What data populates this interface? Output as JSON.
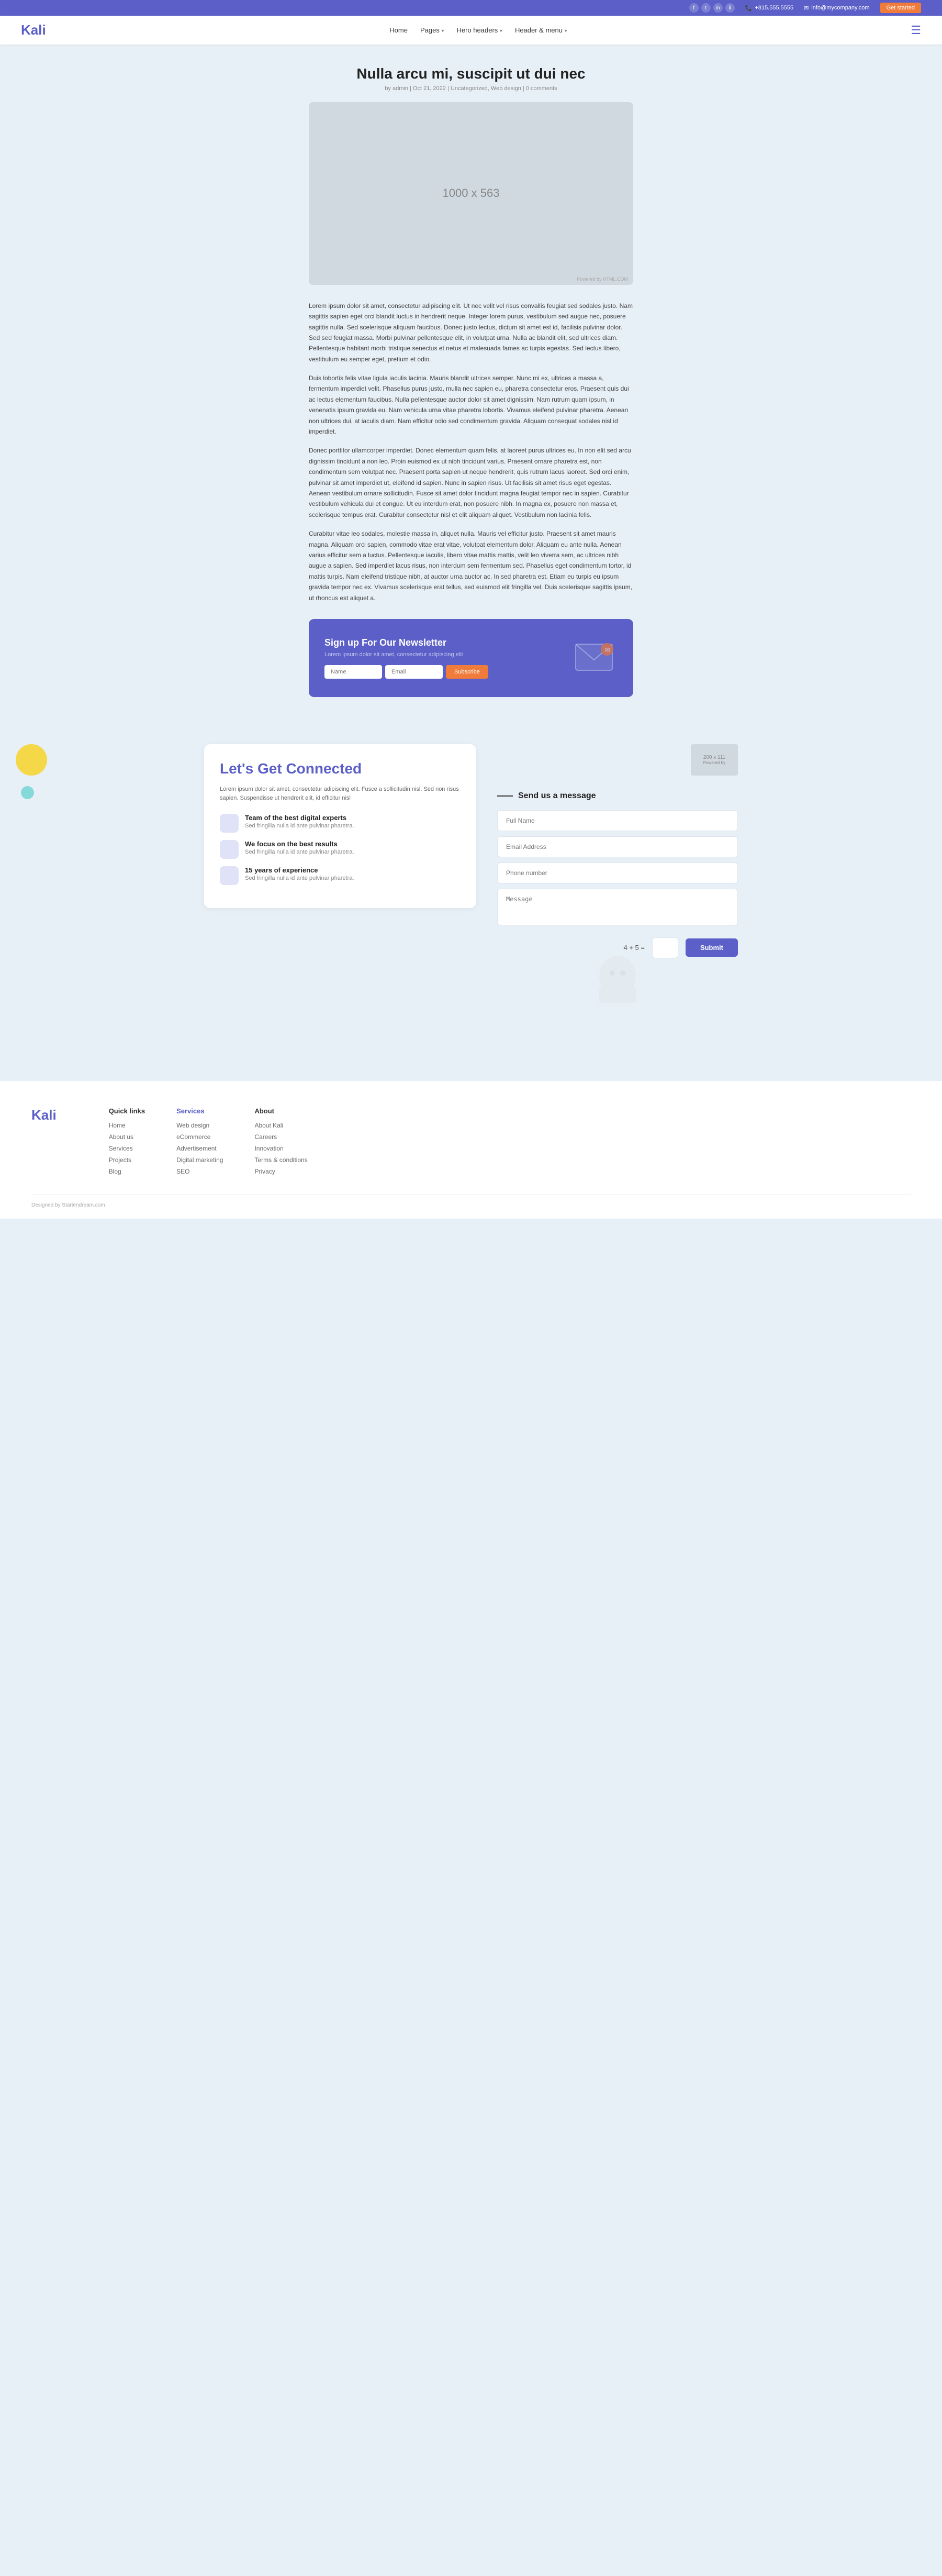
{
  "topbar": {
    "phone": "+815.555.5555",
    "email": "info@mycompany.com",
    "cta_label": "Get started",
    "phone_icon": "📞",
    "email_icon": "✉"
  },
  "navbar": {
    "logo": "Kali",
    "links": [
      {
        "label": "Home",
        "has_arrow": false
      },
      {
        "label": "Pages",
        "has_arrow": true
      },
      {
        "label": "Hero headers",
        "has_arrow": true
      },
      {
        "label": "Header & menu",
        "has_arrow": true
      }
    ]
  },
  "post": {
    "title": "Nulla arcu mi, suscipit ut dui nec",
    "meta": "by admin | Oct 21, 2022 | Uncategorized, Web design | 0 comments",
    "image_label": "1000 x 563",
    "image_powered": "Powered by HTML.COM",
    "body_paragraphs": [
      "Lorem ipsum dolor sit amet, consectetur adipiscing elit. Ut nec velit vel risus convallis feugiat sed sodales justo. Nam sagittis sapien eget orci blandit luctus in hendrerit neque. Integer lorem purus, vestibulum sed augue nec, posuere sagittis nulla. Sed scelerisque aliquam faucibus. Donec justo lectus, dictum sit amet est id, facilisis pulvinar dolor. Sed sed feugiat massa. Morbi pulvinar pellentesque elit, in volutpat urna. Nulla ac blandit elit, sed ultrices diam. Pellentesque habitant morbi tristique senectus et netus et malesuada fames ac turpis egestas. Sed lectus libero, vestibulum eu semper eget, pretium et odio.",
      "Duis lobortis felis vitae ligula iaculis lacinia. Mauris blandit ultrices semper. Nunc mi ex, ultrices a massa a, fermentum imperdiet velit. Phasellus purus justo, mulla nec sapien eu, pharetra consectetur eros. Praesent quis dui ac lectus elementum faucibus. Nulla pellentesque auctor dolor sit amet dignissim. Nam rutrum quam ipsum, in venenatis ipsum gravida eu. Nam vehicula urna vitae pharetra lobortis. Vivamus eleifend pulvinar pharetra. Aenean non ultrices dui, at iaculis diam. Nam efficitur odio sed condimentum gravida. Aliquam consequat sodales nisl id imperdiet.",
      "Donec porttitor ullamcorper imperdiet. Donec elementum quam felis, at laoreet purus ultrices eu. In non elit sed arcu dignissim tincidunt a non leo. Proin euismod ex ut nibh tincidunt varius. Praesent ornare pharetra est, non condimentum sem volutpat nec. Praesent porta sapien ut neque hendrerit, quis rutrum lacus laoreet. Sed orci enim, pulvinar sit amet imperdiet ut, eleifend id sapien. Nunc in sapien risus. Ut facilisis sit amet risus eget egestas. Aenean vestibulum ornare sollicitudin. Fusce sit amet dolor tincidunt magna feugiat tempor nec in sapien. Curabitur vestibulum vehicula dui et congue. Ut eu interdum erat, non posuere nibh. In magna ex, posuere non massa et, scelerisque tempus erat. Curabitur consectetur nisl et elit aliquam aliquet. Vestibulum non lacinia felis.",
      "Curabitur vitae leo sodales, molestie massa in, aliquet nulla. Mauris vel efficitur justo. Praesent sit amet mauris magna. Aliquam orci sapien, commodo vitae erat vitae, volutpat elementum dolor. Aliquam eu ante nulla. Aenean varius efficitur sem a luctus. Pellentesque iaculis, libero vitae mattis mattis, velit leo viverra sem, ac ultrices nibh augue a sapien. Sed imperdiet lacus risus, non interdum sem fermentum sed. Phasellus eget condimentum tortor, id mattis turpis. Nam eleifend tristique nibh, at auctor urna auctor ac. In sed pharetra est. Etiam eu turpis eu ipsum gravida tempor nec ex. Vivamus scelerisque erat tellus, sed euismod elit fringilla vel. Duis scelerisque sagittis ipsum, ut rhoncus est aliquet a."
    ]
  },
  "newsletter": {
    "title": "Sign up For Our Newsletter",
    "subtitle": "Lorem ipsum dolor sit amet, consectetur adipiscing elit",
    "name_placeholder": "Name",
    "email_placeholder": "Email",
    "subscribe_label": "Subscribe"
  },
  "connect_section": {
    "title": "Let's Get Connected",
    "subtitle": "Lorem ipsum dolor sit amet, consectetur adipiscing elit. Fusce a sollicitudin nisl. Sed non risus sapien. Suspendisse ut hendrerit elit, id efficitur nisl",
    "features": [
      {
        "title": "Team of the best digital experts",
        "desc": "Sed fringilla nulla id ante pulvinar pharetra."
      },
      {
        "title": "We focus on the best results",
        "desc": "Sed fringilla nulla id ante pulvinar pharetra."
      },
      {
        "title": "15 years of experience",
        "desc": "Sed fringilla nulla id ante pulvinar pharetra."
      }
    ]
  },
  "contact_form": {
    "heading": "Send us a message",
    "fields": {
      "full_name_placeholder": "Full Name",
      "email_placeholder": "Email Address",
      "phone_placeholder": "Phone number",
      "message_placeholder": "Message"
    },
    "captcha": "4 + 5 =",
    "submit_label": "Submit"
  },
  "footer": {
    "logo": "Kali",
    "quick_links": {
      "heading": "Quick links",
      "items": [
        "Home",
        "About us",
        "Services",
        "Projects",
        "Blog"
      ]
    },
    "services": {
      "heading": "Services",
      "items": [
        "Web design",
        "eCommerce",
        "Advertisement",
        "Digital marketing",
        "SEO"
      ]
    },
    "about": {
      "heading": "About",
      "items": [
        "About Kali",
        "Careers",
        "Innovation",
        "Terms & conditions",
        "Privacy"
      ]
    },
    "copyright": "Designed by Startendream.com"
  },
  "ads_box": {
    "label": "200 x 111",
    "sub": "Powered by"
  }
}
